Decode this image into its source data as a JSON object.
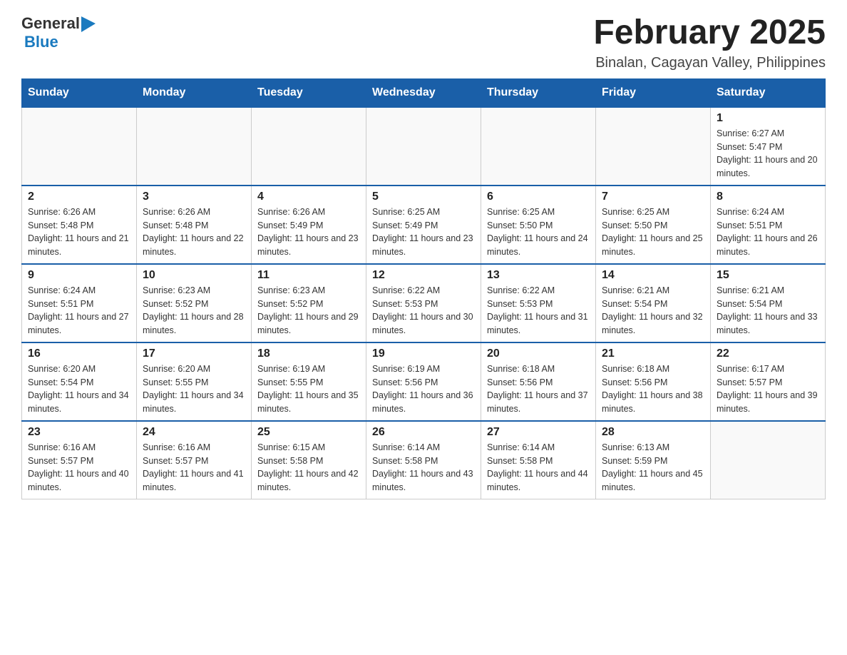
{
  "header": {
    "logo_general": "General",
    "logo_blue": "Blue",
    "main_title": "February 2025",
    "subtitle": "Binalan, Cagayan Valley, Philippines"
  },
  "weekdays": [
    "Sunday",
    "Monday",
    "Tuesday",
    "Wednesday",
    "Thursday",
    "Friday",
    "Saturday"
  ],
  "weeks": [
    [
      {
        "day": "",
        "info": ""
      },
      {
        "day": "",
        "info": ""
      },
      {
        "day": "",
        "info": ""
      },
      {
        "day": "",
        "info": ""
      },
      {
        "day": "",
        "info": ""
      },
      {
        "day": "",
        "info": ""
      },
      {
        "day": "1",
        "info": "Sunrise: 6:27 AM\nSunset: 5:47 PM\nDaylight: 11 hours and 20 minutes."
      }
    ],
    [
      {
        "day": "2",
        "info": "Sunrise: 6:26 AM\nSunset: 5:48 PM\nDaylight: 11 hours and 21 minutes."
      },
      {
        "day": "3",
        "info": "Sunrise: 6:26 AM\nSunset: 5:48 PM\nDaylight: 11 hours and 22 minutes."
      },
      {
        "day": "4",
        "info": "Sunrise: 6:26 AM\nSunset: 5:49 PM\nDaylight: 11 hours and 23 minutes."
      },
      {
        "day": "5",
        "info": "Sunrise: 6:25 AM\nSunset: 5:49 PM\nDaylight: 11 hours and 23 minutes."
      },
      {
        "day": "6",
        "info": "Sunrise: 6:25 AM\nSunset: 5:50 PM\nDaylight: 11 hours and 24 minutes."
      },
      {
        "day": "7",
        "info": "Sunrise: 6:25 AM\nSunset: 5:50 PM\nDaylight: 11 hours and 25 minutes."
      },
      {
        "day": "8",
        "info": "Sunrise: 6:24 AM\nSunset: 5:51 PM\nDaylight: 11 hours and 26 minutes."
      }
    ],
    [
      {
        "day": "9",
        "info": "Sunrise: 6:24 AM\nSunset: 5:51 PM\nDaylight: 11 hours and 27 minutes."
      },
      {
        "day": "10",
        "info": "Sunrise: 6:23 AM\nSunset: 5:52 PM\nDaylight: 11 hours and 28 minutes."
      },
      {
        "day": "11",
        "info": "Sunrise: 6:23 AM\nSunset: 5:52 PM\nDaylight: 11 hours and 29 minutes."
      },
      {
        "day": "12",
        "info": "Sunrise: 6:22 AM\nSunset: 5:53 PM\nDaylight: 11 hours and 30 minutes."
      },
      {
        "day": "13",
        "info": "Sunrise: 6:22 AM\nSunset: 5:53 PM\nDaylight: 11 hours and 31 minutes."
      },
      {
        "day": "14",
        "info": "Sunrise: 6:21 AM\nSunset: 5:54 PM\nDaylight: 11 hours and 32 minutes."
      },
      {
        "day": "15",
        "info": "Sunrise: 6:21 AM\nSunset: 5:54 PM\nDaylight: 11 hours and 33 minutes."
      }
    ],
    [
      {
        "day": "16",
        "info": "Sunrise: 6:20 AM\nSunset: 5:54 PM\nDaylight: 11 hours and 34 minutes."
      },
      {
        "day": "17",
        "info": "Sunrise: 6:20 AM\nSunset: 5:55 PM\nDaylight: 11 hours and 34 minutes."
      },
      {
        "day": "18",
        "info": "Sunrise: 6:19 AM\nSunset: 5:55 PM\nDaylight: 11 hours and 35 minutes."
      },
      {
        "day": "19",
        "info": "Sunrise: 6:19 AM\nSunset: 5:56 PM\nDaylight: 11 hours and 36 minutes."
      },
      {
        "day": "20",
        "info": "Sunrise: 6:18 AM\nSunset: 5:56 PM\nDaylight: 11 hours and 37 minutes."
      },
      {
        "day": "21",
        "info": "Sunrise: 6:18 AM\nSunset: 5:56 PM\nDaylight: 11 hours and 38 minutes."
      },
      {
        "day": "22",
        "info": "Sunrise: 6:17 AM\nSunset: 5:57 PM\nDaylight: 11 hours and 39 minutes."
      }
    ],
    [
      {
        "day": "23",
        "info": "Sunrise: 6:16 AM\nSunset: 5:57 PM\nDaylight: 11 hours and 40 minutes."
      },
      {
        "day": "24",
        "info": "Sunrise: 6:16 AM\nSunset: 5:57 PM\nDaylight: 11 hours and 41 minutes."
      },
      {
        "day": "25",
        "info": "Sunrise: 6:15 AM\nSunset: 5:58 PM\nDaylight: 11 hours and 42 minutes."
      },
      {
        "day": "26",
        "info": "Sunrise: 6:14 AM\nSunset: 5:58 PM\nDaylight: 11 hours and 43 minutes."
      },
      {
        "day": "27",
        "info": "Sunrise: 6:14 AM\nSunset: 5:58 PM\nDaylight: 11 hours and 44 minutes."
      },
      {
        "day": "28",
        "info": "Sunrise: 6:13 AM\nSunset: 5:59 PM\nDaylight: 11 hours and 45 minutes."
      },
      {
        "day": "",
        "info": ""
      }
    ]
  ]
}
